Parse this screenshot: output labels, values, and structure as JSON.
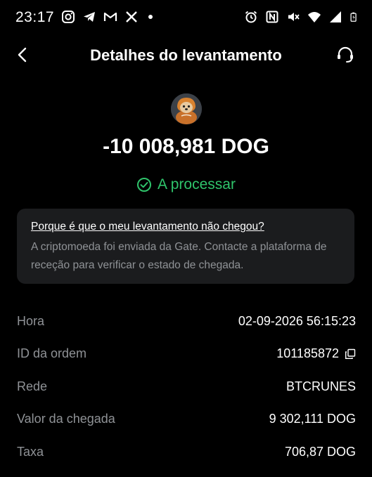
{
  "status_bar": {
    "time": "23:17",
    "left_icons": [
      "instagram-icon",
      "telegram-icon",
      "gmail-icon",
      "x-icon",
      "dot-icon"
    ],
    "right_icons": [
      "alarm-icon",
      "nfc-icon",
      "mute-icon",
      "wifi-icon",
      "signal-icon",
      "battery-icon"
    ]
  },
  "header": {
    "title": "Detalhes do levantamento",
    "back_icon": "chevron-left-icon",
    "support_icon": "headset-icon"
  },
  "transaction": {
    "coin_icon": "dog-coin-avatar",
    "amount": "-10 008,981 DOG",
    "status": "A processar",
    "status_color": "#2fc46b"
  },
  "info_card": {
    "link": "Porque é que o meu levantamento não chegou?",
    "text": "A criptomoeda foi enviada da Gate. Contacte a plataforma de receção para verificar o estado de chegada."
  },
  "details": [
    {
      "label": "Hora",
      "value": "02-09-2026 56:15:23"
    },
    {
      "label": "ID da ordem",
      "value": "101185872"
    },
    {
      "label": "Rede",
      "value": "BTCRUNES"
    },
    {
      "label": "Valor da chegada",
      "value": "9 302,111 DOG"
    },
    {
      "label": "Taxa",
      "value": "706,87 DOG"
    }
  ]
}
